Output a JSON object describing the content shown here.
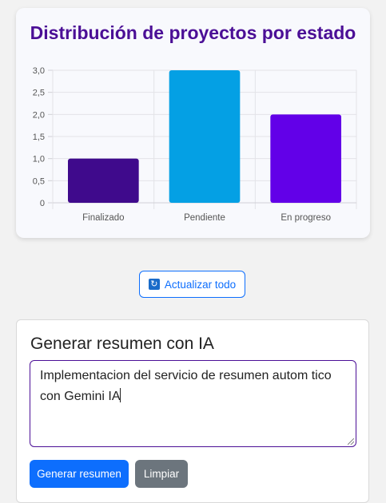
{
  "chart_data": {
    "type": "bar",
    "title": "Distribución de proyectos por estado",
    "categories": [
      "Finalizado",
      "Pendiente",
      "En progreso"
    ],
    "values": [
      1,
      3,
      2
    ],
    "colors": [
      "#3f0a8c",
      "#04a0e4",
      "#6200e8"
    ],
    "ylim": [
      0,
      3
    ],
    "yticks": [
      "0",
      "0,5",
      "1,0",
      "1,5",
      "2,0",
      "2,5",
      "3,0"
    ],
    "grid": true,
    "xlabel": "",
    "ylabel": ""
  },
  "toolbar": {
    "refresh_icon": "refresh-icon",
    "refresh_label": "Actualizar todo"
  },
  "summary": {
    "title": "Generar resumen con IA",
    "text": "Implementacion del servicio de resumen autom tico con Gemini IA",
    "generate_label": "Generar resumen",
    "clear_label": "Limpiar"
  },
  "colors": {
    "accent": "#4b0f96",
    "primary": "#0d6efd",
    "secondary": "#6c757d"
  }
}
